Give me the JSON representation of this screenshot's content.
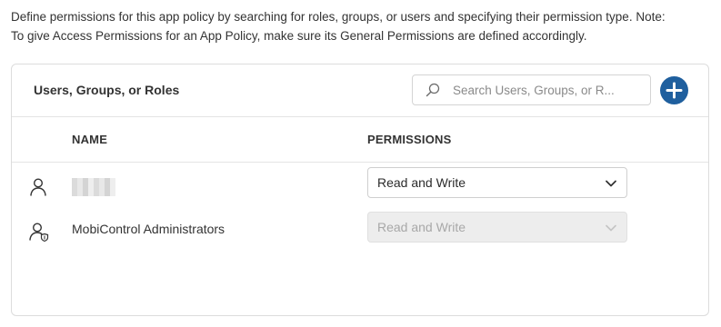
{
  "description": {
    "line1": "Define permissions for this app policy by searching for roles, groups, or users and specifying their permission type. Note:",
    "line2": "To give Access Permissions for an App Policy, make sure its General Permissions are defined accordingly."
  },
  "panel": {
    "title": "Users, Groups, or Roles",
    "search": {
      "placeholder": "Search Users, Groups, or R...",
      "value": ""
    },
    "add_button_icon": "plus-icon",
    "columns": {
      "name": "NAME",
      "permissions": "PERMISSIONS"
    },
    "rows": [
      {
        "icon": "user-icon",
        "name": "",
        "name_redacted": true,
        "permission": "Read and Write",
        "disabled": false
      },
      {
        "icon": "admin-user-icon",
        "name": "MobiControl Administrators",
        "name_redacted": false,
        "permission": "Read and Write",
        "disabled": true
      }
    ]
  },
  "colors": {
    "accent": "#1f5f9e",
    "border": "#dcdcdc",
    "disabled_bg": "#ededed",
    "disabled_text": "#a8a8a8"
  }
}
